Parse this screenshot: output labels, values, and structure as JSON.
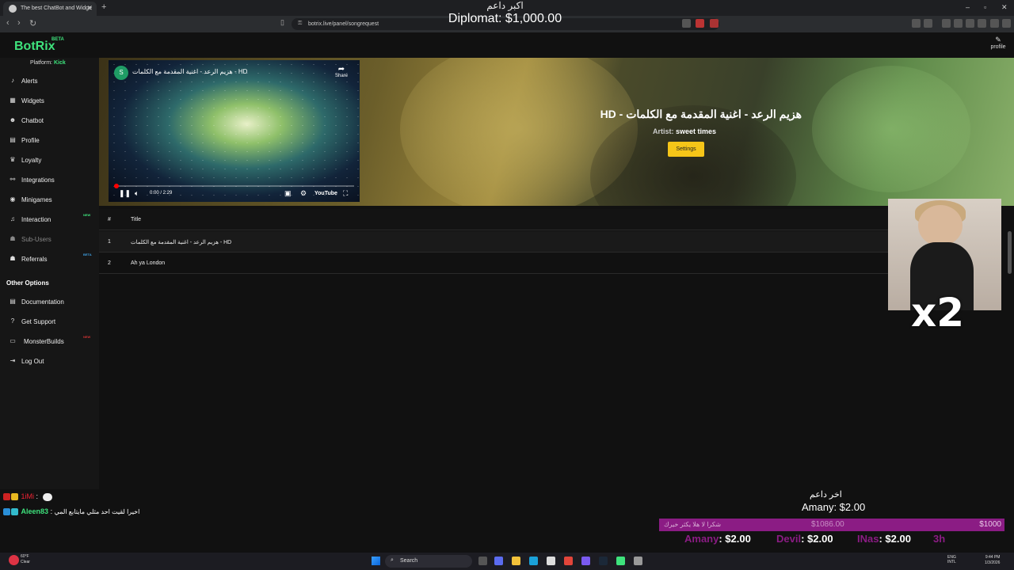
{
  "browser": {
    "tab_title": "The best ChatBot and Widge",
    "url": "botrix.live/panel/songrequest"
  },
  "overlay_top": {
    "label": "اكبر داعم",
    "donor": "Diplomat: $1,000.00"
  },
  "header": {
    "logo": "BotRix",
    "beta": "BETA",
    "profile": "profile"
  },
  "sidebar": {
    "platform_label": "Platform:",
    "platform_value": "Kick",
    "items": [
      {
        "label": "Alerts",
        "icon": "bell-icon"
      },
      {
        "label": "Widgets",
        "icon": "widgets-icon"
      },
      {
        "label": "Chatbot",
        "icon": "robot-icon"
      },
      {
        "label": "Profile",
        "icon": "profile-card-icon"
      },
      {
        "label": "Loyalty",
        "icon": "trophy-icon"
      },
      {
        "label": "Integrations",
        "icon": "link-icon"
      },
      {
        "label": "Minigames",
        "icon": "gamepad-icon"
      },
      {
        "label": "Interaction",
        "icon": "music-icon",
        "badge": "NEW"
      },
      {
        "label": "Sub-Users",
        "icon": "users-icon"
      },
      {
        "label": "Referrals",
        "icon": "users-icon",
        "badge": "BETA"
      }
    ],
    "other_options_title": "Other Options",
    "other_items": [
      {
        "label": "Documentation",
        "icon": "document-icon"
      },
      {
        "label": "Get Support",
        "icon": "question-icon"
      },
      {
        "label": "MonsterBuilds",
        "icon": "laptop-icon",
        "badge": "NEW"
      },
      {
        "label": "Log Out",
        "icon": "logout-icon"
      }
    ]
  },
  "now_playing": {
    "title": "HD - هزيم الرعد - اغنية المقدمة مع الكلمات",
    "artist_label": "Artist:",
    "artist": "sweet times",
    "settings_button": "Settings"
  },
  "player": {
    "channel_initial": "S",
    "video_title": "هزيم الرعد - اغنية المقدمة مع الكلمات - HD",
    "share": "Share",
    "time": "0:00 / 2:29",
    "brand": "YouTube",
    "progress": 0.01
  },
  "song_table": {
    "headers": [
      "#",
      "Title"
    ],
    "rows": [
      {
        "num": "1",
        "title": "هزيم الرعد - اغنية المقدمة مع الكلمات - HD"
      },
      {
        "num": "2",
        "title": "Ah ya London"
      }
    ]
  },
  "gif_overlay": {
    "multiplier": "x2"
  },
  "chat": [
    {
      "user": "1iMi",
      "sep": ":",
      "message": ""
    },
    {
      "user": "Aleen83",
      "sep": ":",
      "message": "اخيرا لقيت احد مثلي مايتابع المي"
    }
  ],
  "donations": {
    "last_label": "اخر داعم",
    "last": "Amany: $2.00",
    "goal_text": "شكرا لا هلا يكثر خيرك",
    "goal_current": "$1086.00",
    "goal_target": "$1000",
    "top": [
      {
        "name": "Amany",
        "amount": ": $2.00"
      },
      {
        "name": "Devil",
        "amount": ": $2.00"
      },
      {
        "name": "INas",
        "amount": ": $2.00"
      },
      {
        "name": "3h",
        "amount": ""
      }
    ],
    "colors": {
      "accent": "#8b1c84"
    }
  },
  "taskbar": {
    "weather_temp": "60°F",
    "weather_desc": "Clear",
    "search": "Search",
    "lang": "ENG",
    "layout": "INTL",
    "time": "9:44 PM",
    "date": "1/3/2026"
  },
  "colors": {
    "brand": "#3ee27c",
    "settings_button": "#f5c518",
    "progress": "#ff0000"
  }
}
